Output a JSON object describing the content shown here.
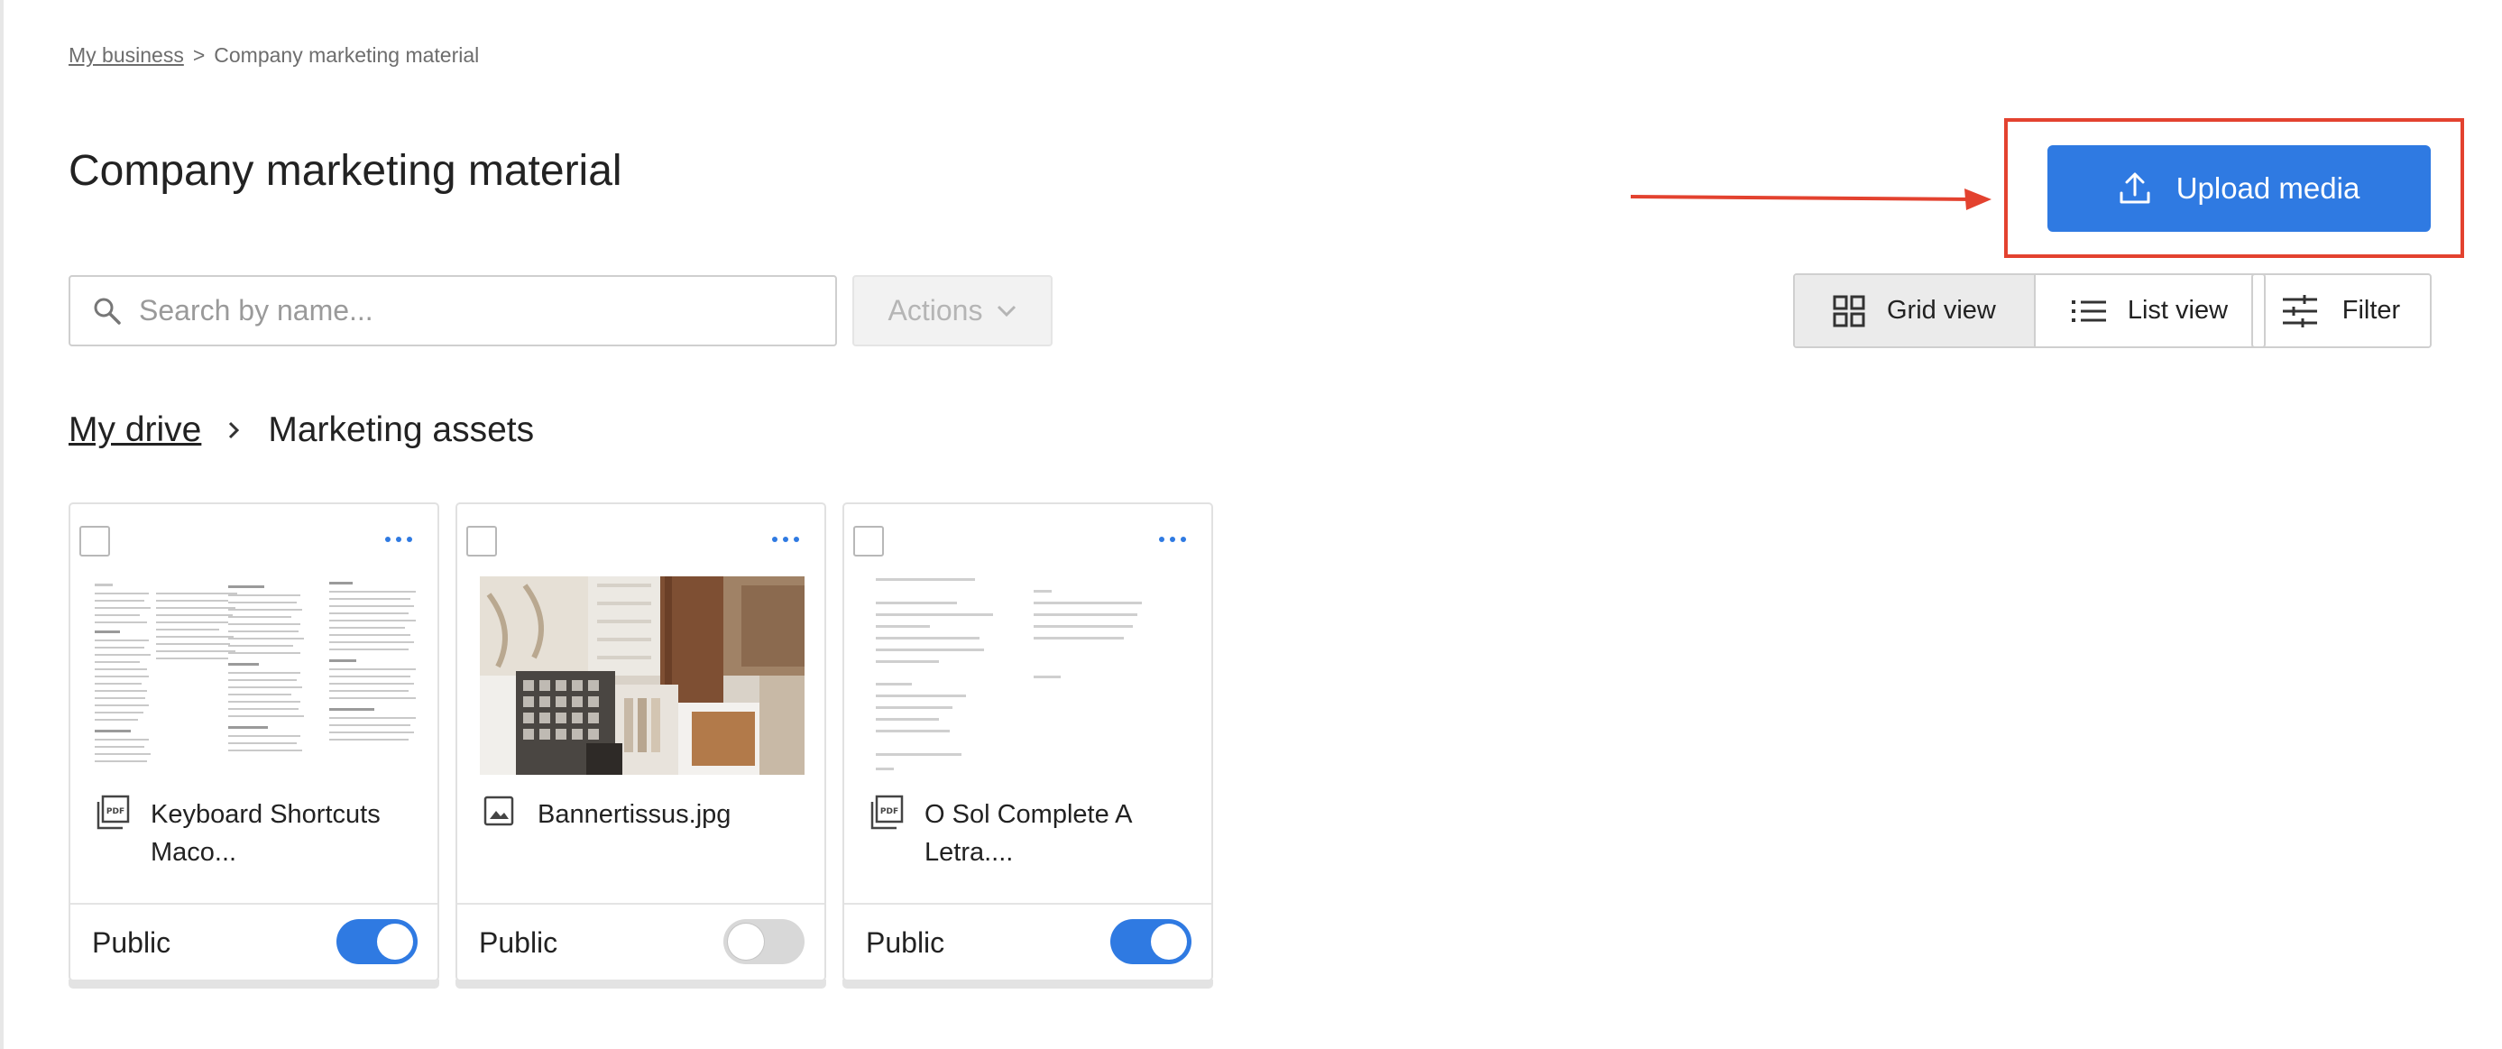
{
  "breadcrumb_top": {
    "root_label": "My business",
    "separator": ">",
    "current_label": "Company marketing material"
  },
  "page": {
    "title": "Company marketing material"
  },
  "toolbar": {
    "upload_label": "Upload media",
    "search_placeholder": "Search by name...",
    "actions_label": "Actions",
    "grid_view_label": "Grid view",
    "list_view_label": "List view",
    "filter_label": "Filter",
    "active_view": "grid"
  },
  "annotation": {
    "highlight_color": "#e3422f"
  },
  "drive_breadcrumb": {
    "root_label": "My drive",
    "current_label": "Marketing assets"
  },
  "files": [
    {
      "name": "Keyboard Shortcuts Maco...",
      "type": "pdf",
      "icon": "pdf-file-icon",
      "visibility_label": "Public",
      "public": true
    },
    {
      "name": "Bannertissus.jpg",
      "type": "image",
      "icon": "image-file-icon",
      "visibility_label": "Public",
      "public": false
    },
    {
      "name": "O Sol Complete A Letra....",
      "type": "pdf",
      "icon": "pdf-file-icon",
      "visibility_label": "Public",
      "public": true
    }
  ],
  "colors": {
    "accent": "#2f7ae2",
    "toggle_off": "#d8d8d8",
    "disabled_text": "#b5b5b5"
  }
}
